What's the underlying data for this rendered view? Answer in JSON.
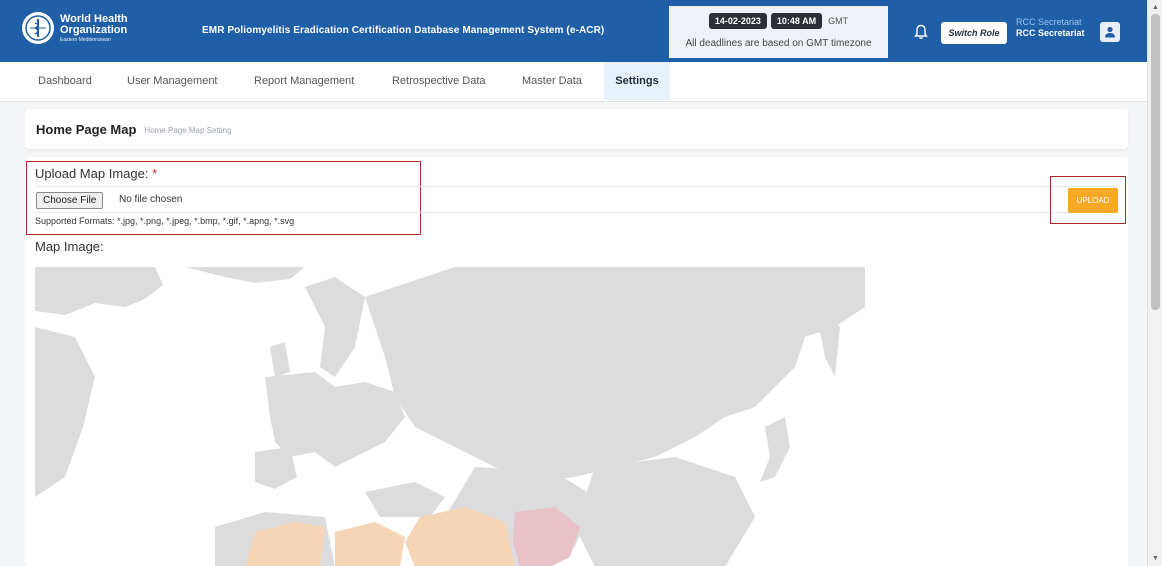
{
  "header": {
    "logo_line1": "World Health",
    "logo_line2": "Organization",
    "logo_line3": "Eastern Mediterranean",
    "app_title": "EMR Poliomyelitis Eradication Certification Database Management System (e-ACR)",
    "date": "14-02-2023",
    "time": "10:48 AM",
    "timezone": "GMT",
    "deadline_note": "All deadlines are based on GMT timezone",
    "switch_role_label": "Switch Role",
    "user_role": "RCC Secretariat",
    "user_name": "RCC Secretariat",
    "brand_color": "#1f5fa8"
  },
  "nav": {
    "items": [
      {
        "label": "Dashboard"
      },
      {
        "label": "User Management"
      },
      {
        "label": "Report Management"
      },
      {
        "label": "Retrospective Data"
      },
      {
        "label": "Master Data"
      },
      {
        "label": "Settings"
      }
    ],
    "active": "Settings"
  },
  "breadcrumb": {
    "title": "Home Page Map",
    "sub": "Home Page Map Setting"
  },
  "upload": {
    "label": "Upload Map Image:",
    "required_mark": "*",
    "choose_label": "Choose File",
    "no_file_text": "No file chosen",
    "formats": "Supported Formats: *.jpg, *.png, *.jpeg, *.bmp, *.gif, *.apng, *.svg",
    "upload_label": "UPLOAD",
    "upload_color": "#f7a825"
  },
  "map": {
    "label": "Map Image:"
  }
}
